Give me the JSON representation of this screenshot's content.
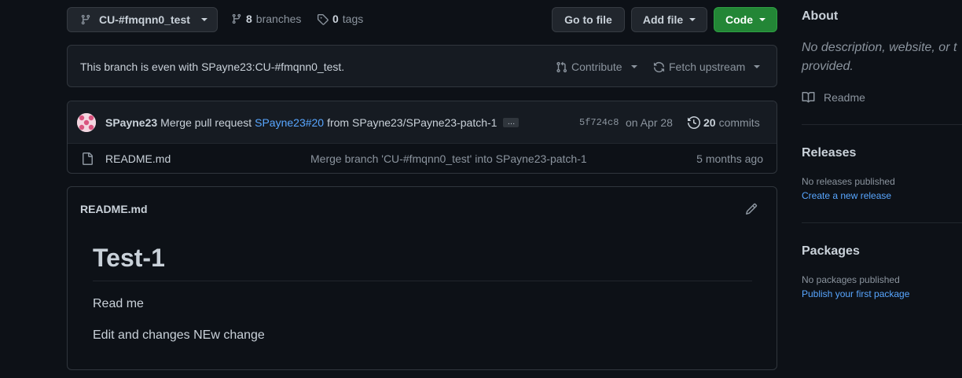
{
  "toolbar": {
    "branch_name": "CU-#fmqnn0_test",
    "branches_count": "8",
    "branches_label": "branches",
    "tags_count": "0",
    "tags_label": "tags",
    "go_to_file": "Go to file",
    "add_file": "Add file",
    "code": "Code"
  },
  "branch_status": {
    "message": "This branch is even with SPayne23:CU-#fmqnn0_test.",
    "contribute": "Contribute",
    "fetch_upstream": "Fetch upstream"
  },
  "commit": {
    "author": "SPayne23",
    "message_prefix": "Merge pull request",
    "pr_link": "SPayne23#20",
    "message_suffix": "from SPayne23/SPayne23-patch-1",
    "ellipsis": "…",
    "sha": "5f724c8",
    "date": "on Apr 28",
    "commits_count": "20",
    "commits_label": "commits"
  },
  "files": [
    {
      "name": "README.md",
      "message": "Merge branch 'CU-#fmqnn0_test' into SPayne23-patch-1",
      "age": "5 months ago"
    }
  ],
  "readme": {
    "filename": "README.md",
    "heading": "Test-1",
    "paragraphs": [
      "Read me",
      "Edit and changes NEw change"
    ]
  },
  "sidebar": {
    "about_title": "About",
    "about_desc_line1": "No description, website, or t",
    "about_desc_line2": "provided.",
    "readme_link": "Readme",
    "releases_title": "Releases",
    "releases_empty": "No releases published",
    "releases_create": "Create a new release",
    "packages_title": "Packages",
    "packages_empty": "No packages published",
    "packages_publish": "Publish your first package"
  },
  "colors": {
    "background": "#0d1117",
    "border": "#30363d",
    "link": "#58a6ff",
    "code_button": "#238636",
    "muted_text": "#8b949e"
  }
}
